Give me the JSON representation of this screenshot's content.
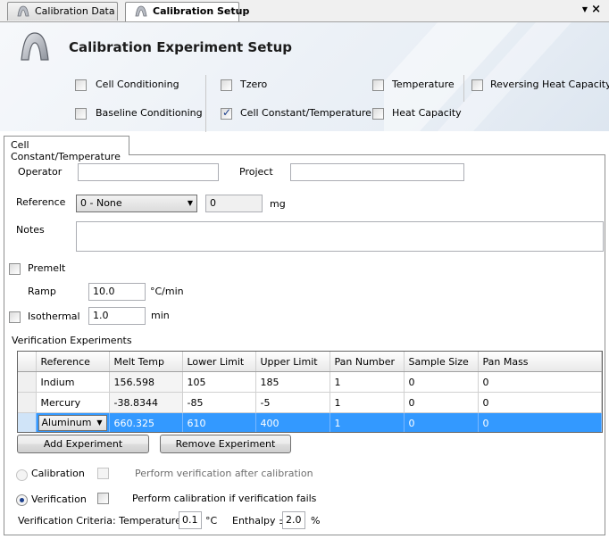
{
  "tabs": [
    {
      "label": "Calibration Data",
      "icon": "ta-logo-icon"
    },
    {
      "label": "Calibration Setup",
      "icon": "ta-logo-icon"
    }
  ],
  "header": {
    "title": "Calibration Experiment Setup"
  },
  "experiments": {
    "cell_conditioning": {
      "label": "Cell Conditioning",
      "checked": false
    },
    "baseline_conditioning": {
      "label": "Baseline Conditioning",
      "checked": false
    },
    "tzero": {
      "label": "Tzero",
      "checked": false
    },
    "cell_constant_temperature": {
      "label": "Cell Constant/Temperature",
      "checked": true
    },
    "temperature": {
      "label": "Temperature",
      "checked": false
    },
    "heat_capacity": {
      "label": "Heat Capacity",
      "checked": false
    },
    "reversing_heat_capacity": {
      "label": "Reversing Heat Capacity",
      "checked": false
    }
  },
  "panel": {
    "tab_label": "Cell Constant/Temperature",
    "operator_label": "Operator",
    "operator_value": "",
    "project_label": "Project",
    "project_value": "",
    "reference_label": "Reference",
    "reference_selected": "0 - None",
    "reference_mass": "0",
    "mass_unit": "mg",
    "notes_label": "Notes",
    "notes_value": "",
    "premelt_label": "Premelt",
    "premelt_checked": false,
    "ramp_label": "Ramp",
    "ramp_value": "10.0",
    "ramp_unit": "°C/min",
    "isothermal_label": "Isothermal",
    "isothermal_checked": false,
    "isothermal_value": "1.0",
    "isothermal_unit": "min"
  },
  "verification": {
    "section_label": "Verification Experiments",
    "columns": [
      "Reference",
      "Melt Temp",
      "Lower Limit",
      "Upper Limit",
      "Pan Number",
      "Sample Size",
      "Pan Mass"
    ],
    "rows": [
      {
        "reference": "Indium",
        "melt_temp": "156.598",
        "lower": "105",
        "upper": "185",
        "pan_number": "1",
        "sample_size": "0",
        "pan_mass": "0"
      },
      {
        "reference": "Mercury",
        "melt_temp": "-38.8344",
        "lower": "-85",
        "upper": "-5",
        "pan_number": "1",
        "sample_size": "0",
        "pan_mass": "0"
      },
      {
        "reference": "Aluminum",
        "melt_temp": "660.325",
        "lower": "610",
        "upper": "400",
        "pan_number": "1",
        "sample_size": "0",
        "pan_mass": "0"
      }
    ],
    "add_label": "Add Experiment",
    "remove_label": "Remove Experiment"
  },
  "mode": {
    "calibration_label": "Calibration",
    "verification_label": "Verification",
    "selected": "verification",
    "perform_verification_label": "Perform verification after calibration",
    "perform_calibration_label": "Perform calibration if verification fails"
  },
  "criteria": {
    "label": "Verification Criteria: Temperature ±",
    "temperature_value": "0.1",
    "temperature_unit": "°C",
    "enthalpy_label": "Enthalpy ±",
    "enthalpy_value": "2.0",
    "enthalpy_unit": "%"
  },
  "colors": {
    "selection": "#3399ff",
    "accent_check": "#1c3f8c"
  }
}
